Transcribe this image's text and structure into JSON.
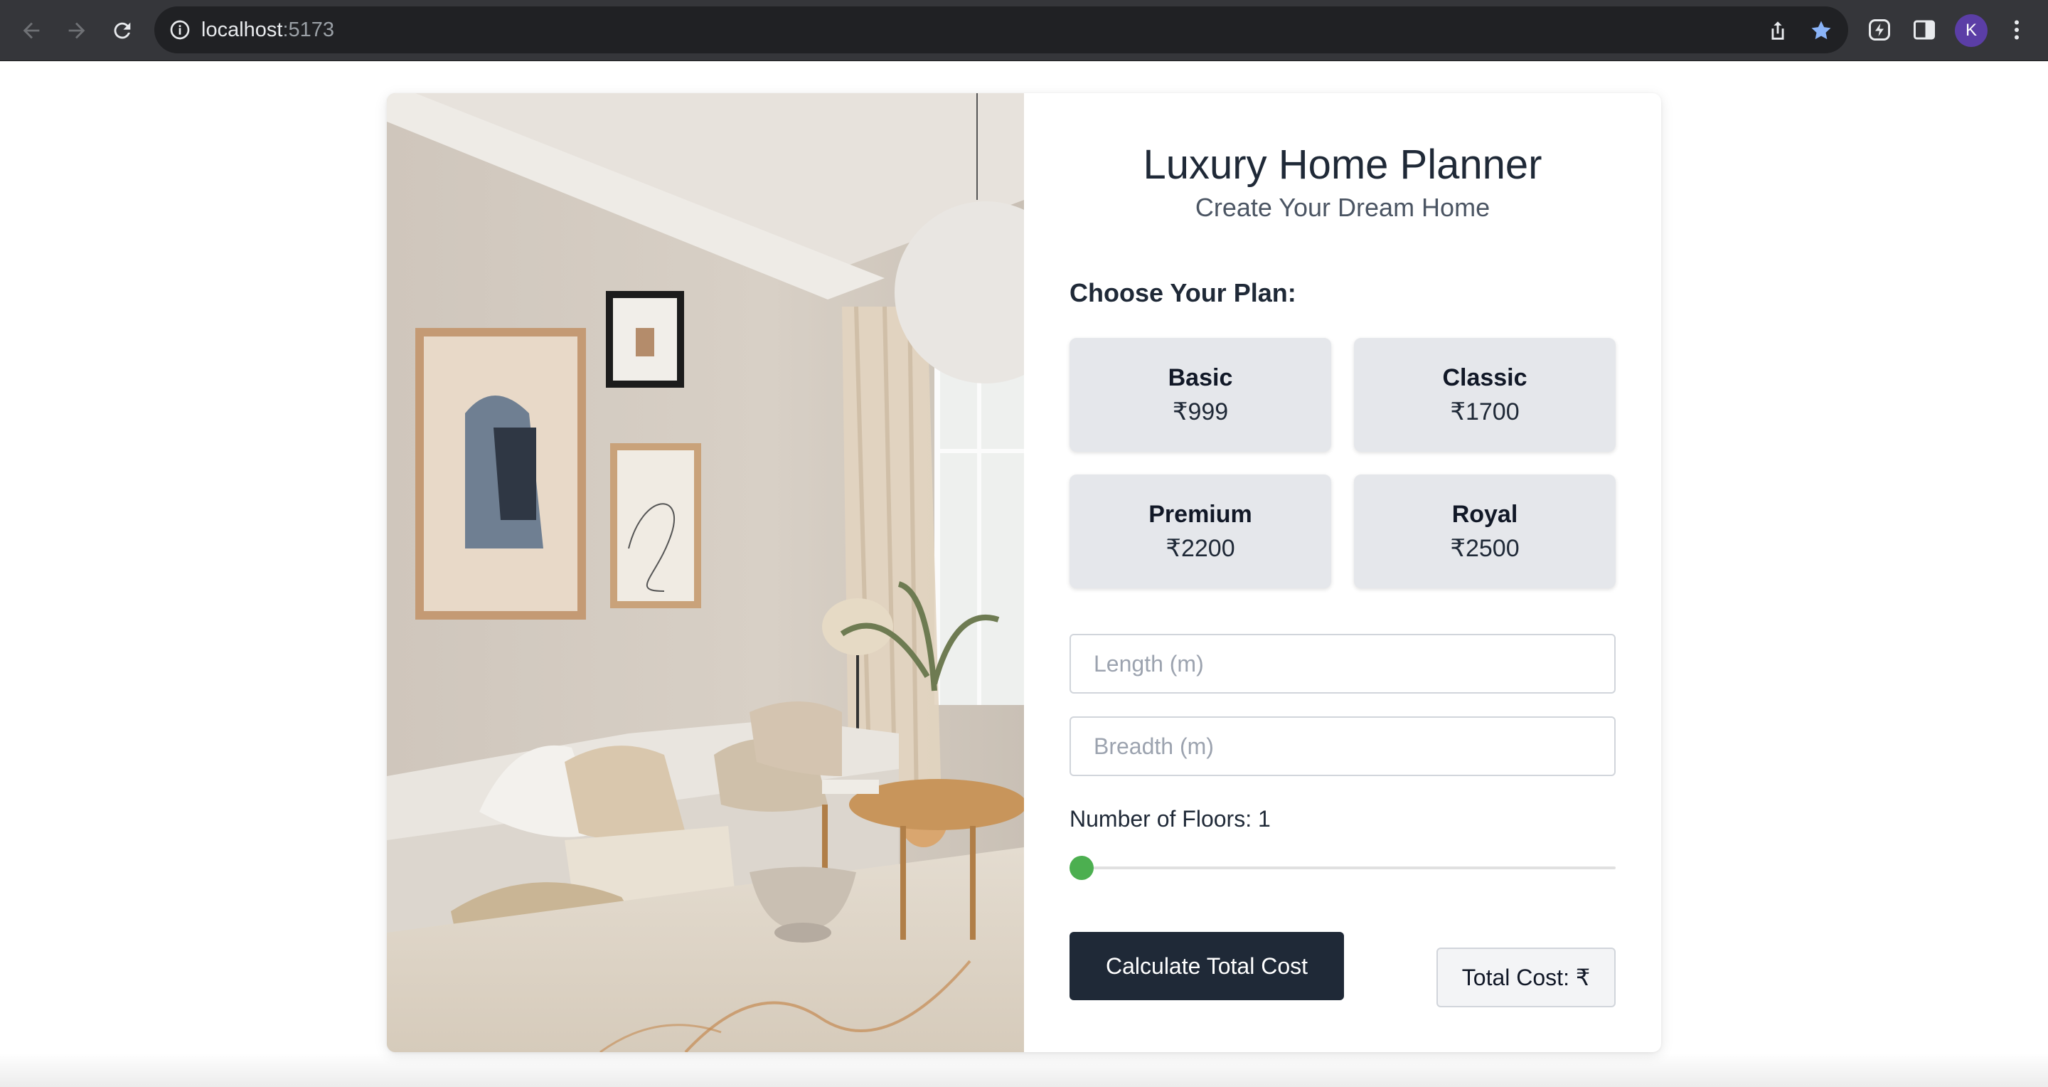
{
  "browser": {
    "url_host": "localhost",
    "url_port": ":5173",
    "profile_initial": "K",
    "icons": [
      "back-arrow-icon",
      "forward-arrow-icon",
      "reload-icon",
      "info-icon",
      "share-icon",
      "star-icon",
      "extension-icon",
      "side-panel-icon",
      "more-menu-icon"
    ],
    "colors": {
      "star": "#8ab4f8",
      "avatar": "#5b3ea6"
    }
  },
  "header": {
    "title": "Luxury Home Planner",
    "subtitle": "Create Your Dream Home"
  },
  "plans": {
    "heading": "Choose Your Plan:",
    "items": [
      {
        "name": "Basic",
        "price": "₹999"
      },
      {
        "name": "Classic",
        "price": "₹1700"
      },
      {
        "name": "Premium",
        "price": "₹2200"
      },
      {
        "name": "Royal",
        "price": "₹2500"
      }
    ]
  },
  "form": {
    "length_placeholder": "Length (m)",
    "breadth_placeholder": "Breadth (m)",
    "floors_label": "Number of Floors: 1",
    "floors_value": 1,
    "slider_color": "#4caf50"
  },
  "actions": {
    "calculate_label": "Calculate Total Cost",
    "total_label": "Total Cost: ₹"
  },
  "image": {
    "subject": "living-room-interior"
  }
}
